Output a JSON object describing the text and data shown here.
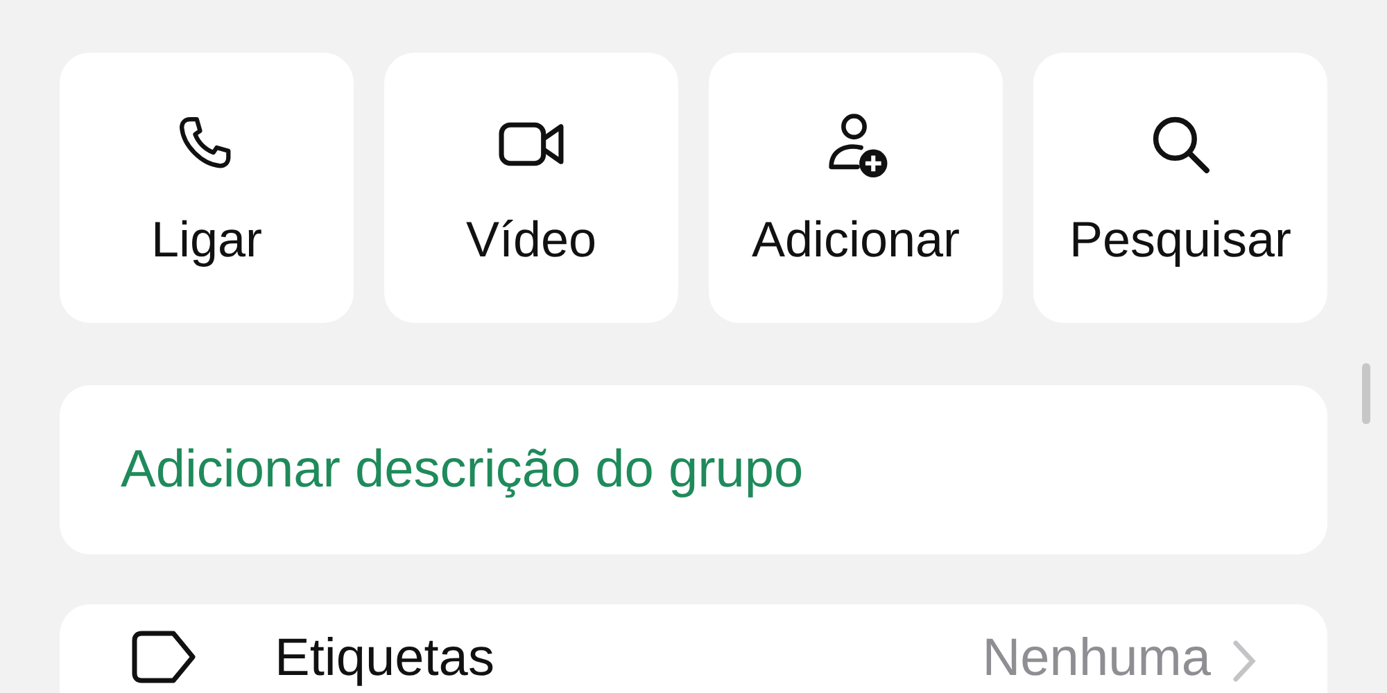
{
  "actions": [
    {
      "kind": "call",
      "label": "Ligar"
    },
    {
      "kind": "video",
      "label": "Vídeo"
    },
    {
      "kind": "add",
      "label": "Adicionar"
    },
    {
      "kind": "search",
      "label": "Pesquisar"
    }
  ],
  "description_link": "Adicionar descrição do grupo",
  "settings_rows": [
    {
      "label": "Etiquetas",
      "value": "Nenhuma"
    }
  ]
}
